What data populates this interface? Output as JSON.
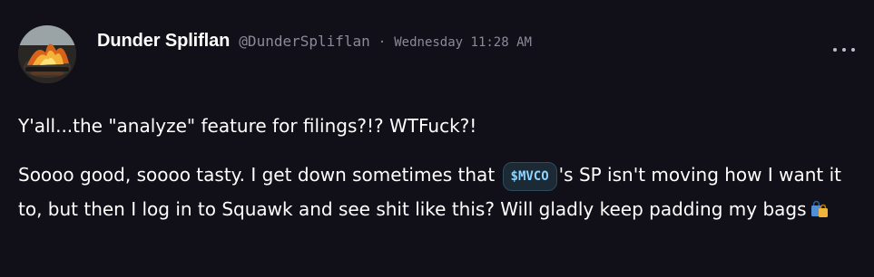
{
  "author": {
    "name": "Dunder Spliflan",
    "handle": "@DunderSpliflan",
    "separator": "·",
    "timestamp": "Wednesday 11:28 AM",
    "avatar_icon": "campfire-avatar"
  },
  "menu": {
    "icon": "more-horizontal-icon"
  },
  "post": {
    "line1": "Y'all...the \"analyze\" feature for filings?!? WTFuck?!",
    "line2_before": "Soooo good, soooo tasty. I get down sometimes that ",
    "ticker": "$MVCO",
    "line2_after": "'s SP isn't moving how I want it to, but then I log in to Squawk and see shit like this? Will gladly keep padding my bags",
    "emoji": "shopping-bags-icon"
  },
  "colors": {
    "background": "#111018",
    "text": "#ffffff",
    "muted": "#8b8a98",
    "ticker_text": "#8fd3ff",
    "ticker_bg": "#1b2a35"
  }
}
